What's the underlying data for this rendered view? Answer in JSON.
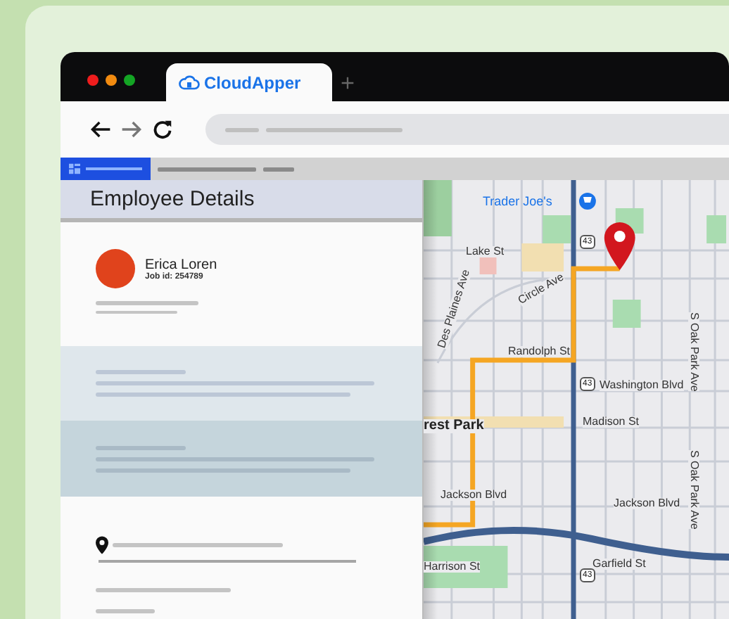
{
  "browser": {
    "tab": {
      "title": "CloudApper",
      "selected": true
    }
  },
  "panel": {
    "title": "Employee Details",
    "employee": {
      "name": "Erica Loren",
      "job_id": "Job id: 254789"
    }
  },
  "map": {
    "labels": [
      {
        "text": "Trader Joe's",
        "kind": "poi"
      },
      {
        "text": "Lake St",
        "kind": "street"
      },
      {
        "text": "Circle Ave",
        "kind": "street"
      },
      {
        "text": "Des Plaines Ave",
        "kind": "street"
      },
      {
        "text": "Randolph St",
        "kind": "street"
      },
      {
        "text": "Washington Blvd",
        "kind": "street"
      },
      {
        "text": "rest Park",
        "kind": "area"
      },
      {
        "text": "Madison St",
        "kind": "street"
      },
      {
        "text": "Jackson Blvd",
        "kind": "street"
      },
      {
        "text": "Jackson Blvd",
        "kind": "street"
      },
      {
        "text": "Harrison St",
        "kind": "street"
      },
      {
        "text": "Garfield St",
        "kind": "street"
      },
      {
        "text": "S Oak Park Ave",
        "kind": "street"
      },
      {
        "text": "S Oak Park Ave",
        "kind": "street"
      },
      {
        "text": "43",
        "kind": "shield"
      },
      {
        "text": "43",
        "kind": "shield"
      },
      {
        "text": "43",
        "kind": "shield"
      }
    ]
  }
}
